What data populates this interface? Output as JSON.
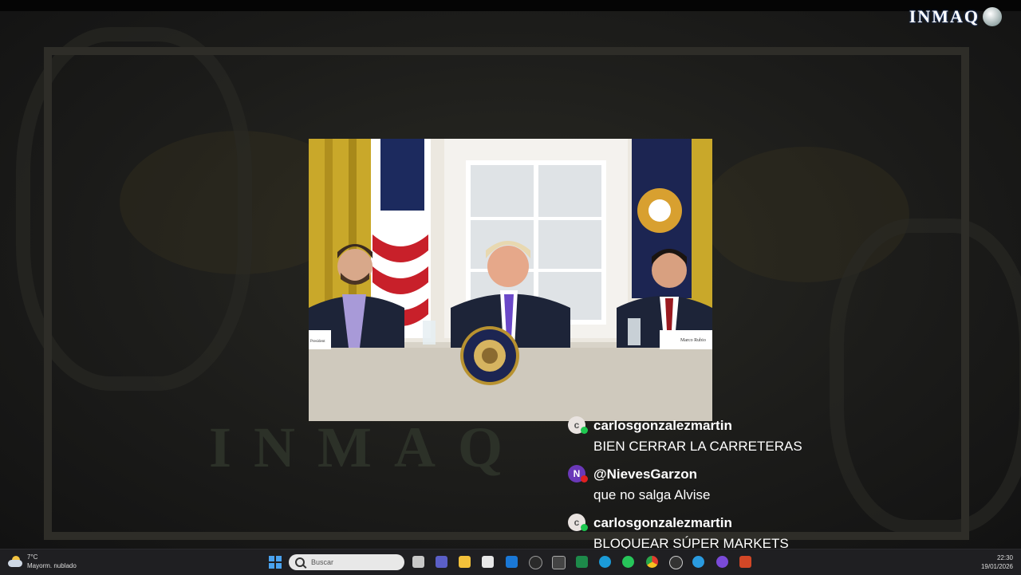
{
  "channel": {
    "logo_text": "INMAQ",
    "watermark_text": "INMAQ"
  },
  "chat": {
    "messages": [
      {
        "avatar_letter": "c",
        "username": "carlosgonzalezmartin",
        "text": "BIEN CERRAR LA CARRETERAS",
        "avatar_color": "#e9e3e0",
        "badge_color": "#1ec850"
      },
      {
        "avatar_letter": "N",
        "username": "@NievesGarzon",
        "text": "que no salga Alvise",
        "avatar_color": "#6a38b8",
        "badge_color": "#e02020"
      },
      {
        "avatar_letter": "c",
        "username": "carlosgonzalezmartin",
        "text": "BLOQUEAR SÚPER MARKETS",
        "avatar_color": "#e9e3e0",
        "badge_color": "#1ec850"
      }
    ]
  },
  "photo": {
    "nameplate_left": "President",
    "nameplate_right": "Marco Rubio"
  },
  "taskbar": {
    "weather_temp": "7°C",
    "weather_desc": "Mayorm. nublado",
    "search_placeholder": "Buscar",
    "time": "22:30",
    "date": "19/01/2026",
    "icons": [
      "task-view-icon",
      "teams-icon",
      "file-explorer-icon",
      "store-icon",
      "outlook-icon",
      "chatgpt-icon",
      "app-icon",
      "excel-icon",
      "edge-icon",
      "whatsapp-icon",
      "chrome-icon",
      "obs-icon",
      "telegram-icon",
      "app-purple-icon",
      "powerpoint-icon"
    ]
  }
}
